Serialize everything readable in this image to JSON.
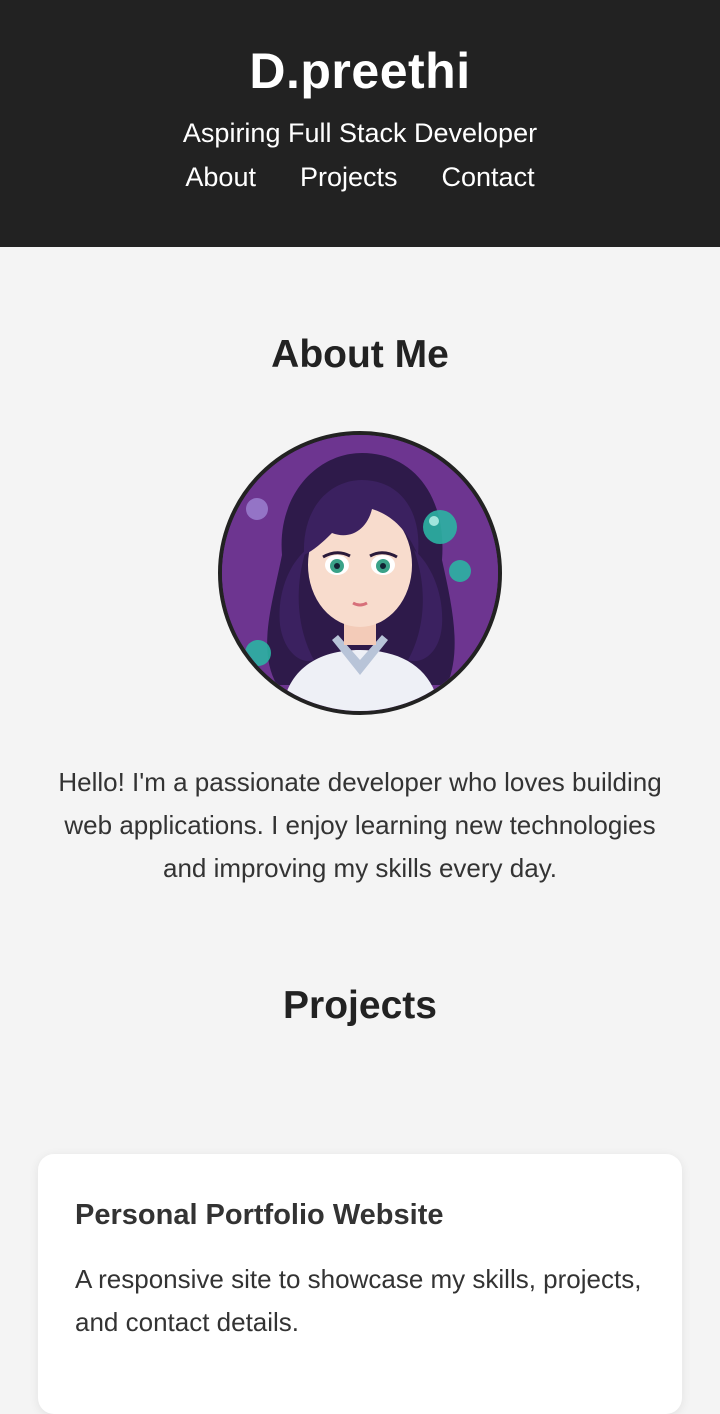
{
  "header": {
    "title": "D.preethi",
    "tagline": "Aspiring Full Stack Developer",
    "nav": [
      {
        "label": "About"
      },
      {
        "label": "Projects"
      },
      {
        "label": "Contact"
      }
    ]
  },
  "about": {
    "heading": "About Me",
    "avatar_icon": "profile-avatar-illustration",
    "text": "Hello! I'm a passionate developer who loves building web applications. I enjoy learning new technologies and improving my skills every day."
  },
  "projects": {
    "heading": "Projects",
    "items": [
      {
        "title": "Personal Portfolio Website",
        "description": "A responsive site to showcase my skills, projects, and contact details."
      }
    ]
  },
  "colors": {
    "header_bg": "#222222",
    "page_bg": "#f4f4f4",
    "card_bg": "#ffffff",
    "avatar_bg": "#6d3590"
  }
}
